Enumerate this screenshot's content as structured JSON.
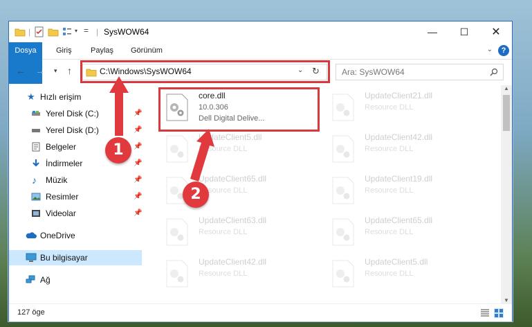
{
  "window": {
    "title": "SysWOW64"
  },
  "ribbon": {
    "tabs": [
      "Dosya",
      "Giriş",
      "Paylaş",
      "Görünüm"
    ]
  },
  "address": {
    "path": "C:\\Windows\\SysWOW64"
  },
  "search": {
    "placeholder": "Ara: SysWOW64"
  },
  "sidebar": {
    "items": [
      {
        "label": "Hızlı erişim",
        "icon": "star-icon"
      },
      {
        "label": "Yerel Disk (C:)",
        "icon": "drive-icon"
      },
      {
        "label": "Yerel Disk (D:)",
        "icon": "drive-icon"
      },
      {
        "label": "Belgeler",
        "icon": "documents-icon"
      },
      {
        "label": "İndirmeler",
        "icon": "download-icon"
      },
      {
        "label": "Müzik",
        "icon": "music-icon"
      },
      {
        "label": "Resimler",
        "icon": "pictures-icon"
      },
      {
        "label": "Videolar",
        "icon": "videos-icon"
      },
      {
        "label": "OneDrive",
        "icon": "cloud-icon"
      },
      {
        "label": "Bu bilgisayar",
        "icon": "computer-icon"
      },
      {
        "label": "Ağ",
        "icon": "network-icon"
      }
    ]
  },
  "files": [
    {
      "name": "core.dll",
      "version": "10.0.306",
      "desc": "Dell Digital Delive..."
    },
    {
      "name": "UpdateClient21.dll",
      "desc": "Resource DLL"
    },
    {
      "name": "UpdateClient5.dll",
      "desc": "Resource DLL"
    },
    {
      "name": "UpdateClient42.dll",
      "desc": "Resource DLL"
    },
    {
      "name": "UpdateClient65.dll",
      "desc": "Resource DLL"
    },
    {
      "name": "UpdateClient19.dll",
      "desc": "Resource DLL"
    },
    {
      "name": "UpdateClient63.dll",
      "desc": "Resource DLL"
    },
    {
      "name": "UpdateClient65.dll",
      "desc": "Resource DLL"
    },
    {
      "name": "UpdateClient42.dll",
      "desc": "Resource DLL"
    },
    {
      "name": "UpdateClient5.dll",
      "desc": "Resource DLL"
    }
  ],
  "status": {
    "count": "127 öge"
  },
  "annotations": {
    "step1": "1",
    "step2": "2"
  },
  "colors": {
    "accent": "#1979ca",
    "highlight": "#d9393e"
  }
}
